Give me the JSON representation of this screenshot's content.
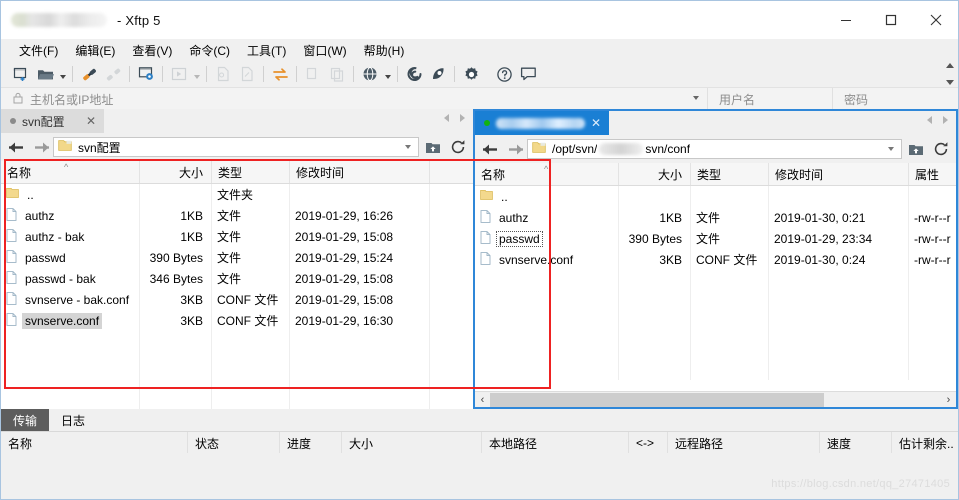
{
  "window": {
    "title_suffix": "- Xftp 5",
    "minimize": "—",
    "maximize": "□",
    "close": "✕"
  },
  "menu": {
    "items": [
      {
        "label": "文件(F)"
      },
      {
        "label": "编辑(E)"
      },
      {
        "label": "查看(V)"
      },
      {
        "label": "命令(C)"
      },
      {
        "label": "工具(T)"
      },
      {
        "label": "窗口(W)"
      },
      {
        "label": "帮助(H)"
      }
    ]
  },
  "toolbar": {
    "icons": [
      "new-session-icon",
      "open-folder-icon",
      "open-folder-dropdown-icon",
      "connect-icon",
      "disconnect-icon",
      "session-settings-icon",
      "transfer-icon",
      "transfer-dropdown-icon",
      "new-file-icon",
      "edit-file-icon",
      "sync-browse-icon",
      "copy-icon",
      "paste-icon",
      "browser-icon",
      "browser-dropdown-icon",
      "xshell-icon",
      "xftp-icon",
      "options-icon",
      "help-icon",
      "feedback-icon"
    ]
  },
  "connection_bar": {
    "lock_icon": "lock-icon",
    "host_placeholder": "主机名或IP地址",
    "username_placeholder": "用户名",
    "password_placeholder": "密码"
  },
  "left_pane": {
    "tab": {
      "label": "svn配置",
      "close": "✕",
      "status_icon": "status-dot-icon"
    },
    "path": {
      "value": "svn配置",
      "folder_icon": "folder-icon"
    },
    "buttons": {
      "up_dir": "up-directory-icon",
      "refresh": "refresh-icon"
    },
    "columns": [
      {
        "key": "name",
        "label": "名称"
      },
      {
        "key": "size",
        "label": "大小"
      },
      {
        "key": "type",
        "label": "类型"
      },
      {
        "key": "mtime",
        "label": "修改时间"
      }
    ],
    "rows": [
      {
        "name": "..",
        "size": "",
        "type": "文件夹",
        "mtime": "",
        "icon": "folder-icon",
        "selected": false
      },
      {
        "name": "authz",
        "size": "1KB",
        "type": "文件",
        "mtime": "2019-01-29, 16:26",
        "icon": "file-icon",
        "selected": false
      },
      {
        "name": "authz - bak",
        "size": "1KB",
        "type": "文件",
        "mtime": "2019-01-29, 15:08",
        "icon": "file-icon",
        "selected": false
      },
      {
        "name": "passwd",
        "size": "390 Bytes",
        "type": "文件",
        "mtime": "2019-01-29, 15:24",
        "icon": "file-icon",
        "selected": false
      },
      {
        "name": "passwd - bak",
        "size": "346 Bytes",
        "type": "文件",
        "mtime": "2019-01-29, 15:08",
        "icon": "file-icon",
        "selected": false
      },
      {
        "name": "svnserve - bak.conf",
        "size": "3KB",
        "type": "CONF 文件",
        "mtime": "2019-01-29, 15:08",
        "icon": "file-icon",
        "selected": false
      },
      {
        "name": "svnserve.conf",
        "size": "3KB",
        "type": "CONF 文件",
        "mtime": "2019-01-29, 16:30",
        "icon": "file-icon",
        "selected": true
      }
    ]
  },
  "right_pane": {
    "tab": {
      "label": "",
      "close": "✕",
      "status_icon": "status-dot-connected-icon"
    },
    "path": {
      "prefix": "/opt/svn/",
      "suffix": "svn/conf",
      "folder_icon": "folder-icon"
    },
    "buttons": {
      "up_dir": "up-directory-icon",
      "refresh": "refresh-icon"
    },
    "columns": [
      {
        "key": "name",
        "label": "名称"
      },
      {
        "key": "size",
        "label": "大小"
      },
      {
        "key": "type",
        "label": "类型"
      },
      {
        "key": "mtime",
        "label": "修改时间"
      },
      {
        "key": "attr",
        "label": "属性"
      }
    ],
    "rows": [
      {
        "name": "..",
        "size": "",
        "type": "",
        "mtime": "",
        "attr": "",
        "icon": "folder-icon",
        "focused": false
      },
      {
        "name": "authz",
        "size": "1KB",
        "type": "文件",
        "mtime": "2019-01-30, 0:21",
        "attr": "-rw-r--r",
        "icon": "file-icon",
        "focused": false
      },
      {
        "name": "passwd",
        "size": "390 Bytes",
        "type": "文件",
        "mtime": "2019-01-29, 23:34",
        "attr": "-rw-r--r",
        "icon": "file-icon",
        "focused": true
      },
      {
        "name": "svnserve.conf",
        "size": "3KB",
        "type": "CONF 文件",
        "mtime": "2019-01-30, 0:24",
        "attr": "-rw-r--r",
        "icon": "file-icon",
        "focused": false
      }
    ],
    "hscroll": {
      "left_arrow": "‹",
      "right_arrow": "›"
    }
  },
  "bottom_panel": {
    "tabs": [
      {
        "label": "传输",
        "active": true
      },
      {
        "label": "日志",
        "active": false
      }
    ],
    "columns": [
      {
        "key": "name",
        "label": "名称"
      },
      {
        "key": "status",
        "label": "状态"
      },
      {
        "key": "progress",
        "label": "进度"
      },
      {
        "key": "size",
        "label": "大小"
      },
      {
        "key": "local",
        "label": "本地路径"
      },
      {
        "key": "dir",
        "label": "<->"
      },
      {
        "key": "remote",
        "label": "远程路径"
      },
      {
        "key": "speed",
        "label": "速度"
      },
      {
        "key": "eta",
        "label": "估计剩余.."
      }
    ],
    "rows": []
  },
  "watermark": "https://blog.csdn.net/qq_27471405",
  "colors": {
    "accent_blue": "#1a7fd4",
    "pane_border": "#2f87d8",
    "highlight_red": "#ee2222",
    "selection_gray": "#d4d4d4"
  }
}
